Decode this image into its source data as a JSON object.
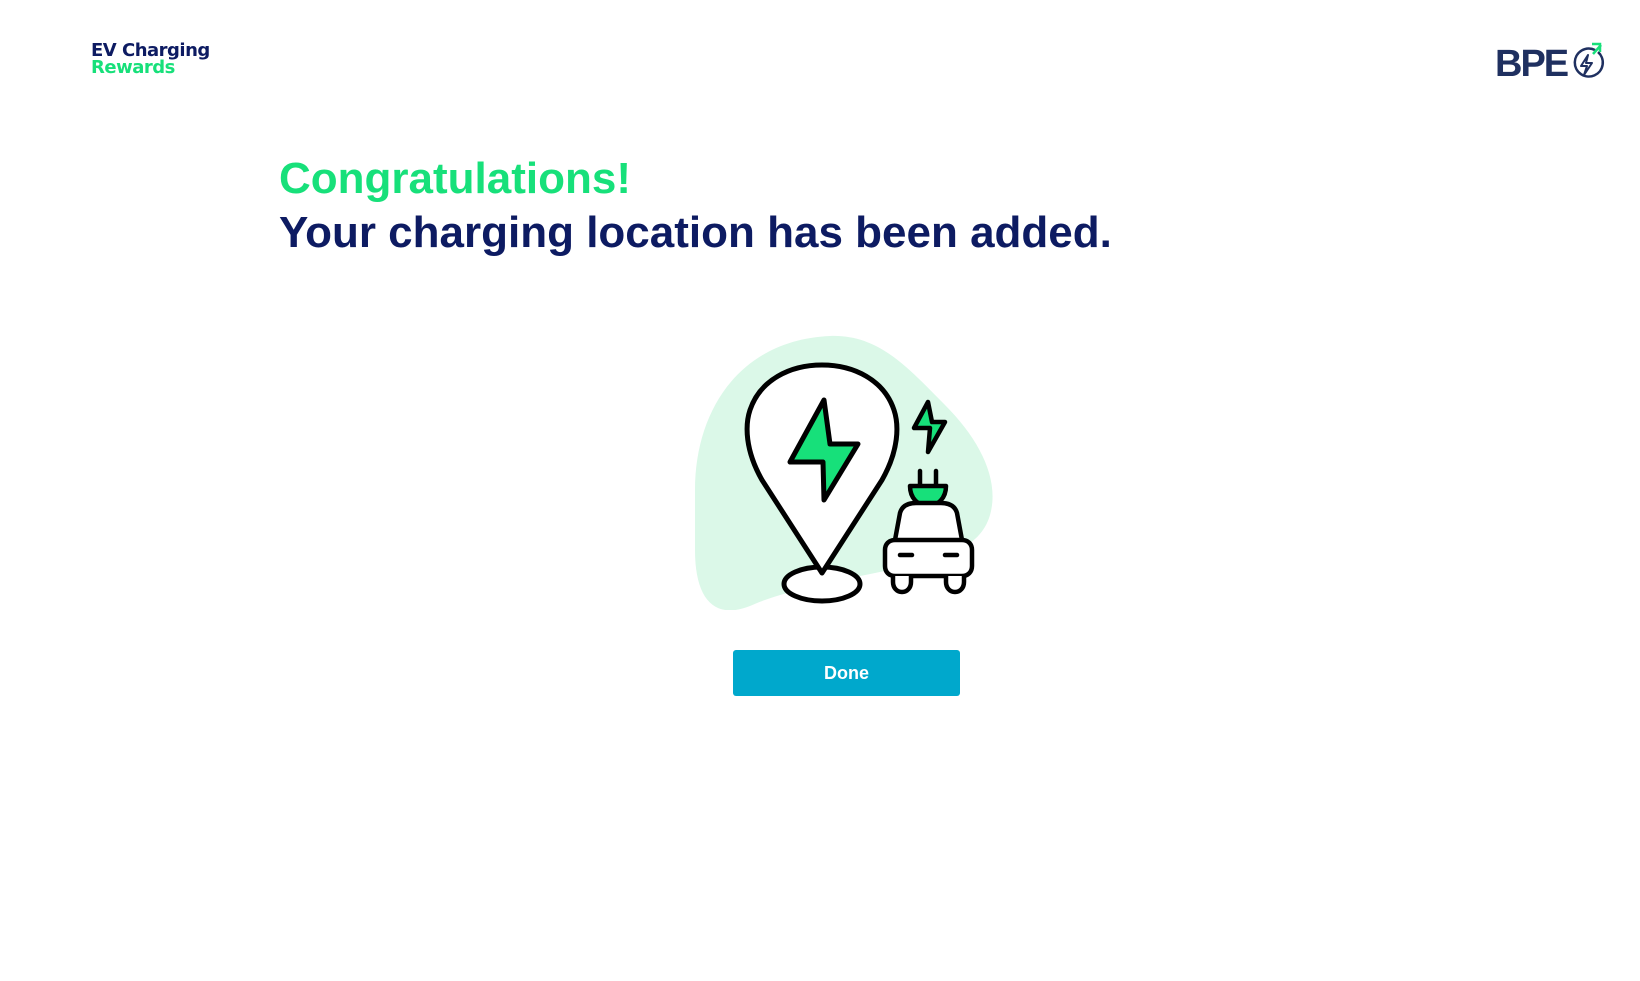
{
  "header": {
    "brand_line1": "EV Charging",
    "brand_line2": "Rewards",
    "partner_logo_text": "BPE",
    "partner_logo_icon": "lightning-circle-icon"
  },
  "main": {
    "congrats_title": "Congratulations!",
    "message": "Your charging location has been added.",
    "illustration_icons": [
      "location-pin-lightning-icon",
      "lightning-icon",
      "plug-icon",
      "car-icon"
    ],
    "done_button_label": "Done"
  },
  "colors": {
    "brand_green": "#17e07a",
    "brand_navy": "#0d1b62",
    "button_blue": "#00a8cc",
    "blob_mint": "#dbf8e8",
    "logo_navy": "#1f3060"
  }
}
